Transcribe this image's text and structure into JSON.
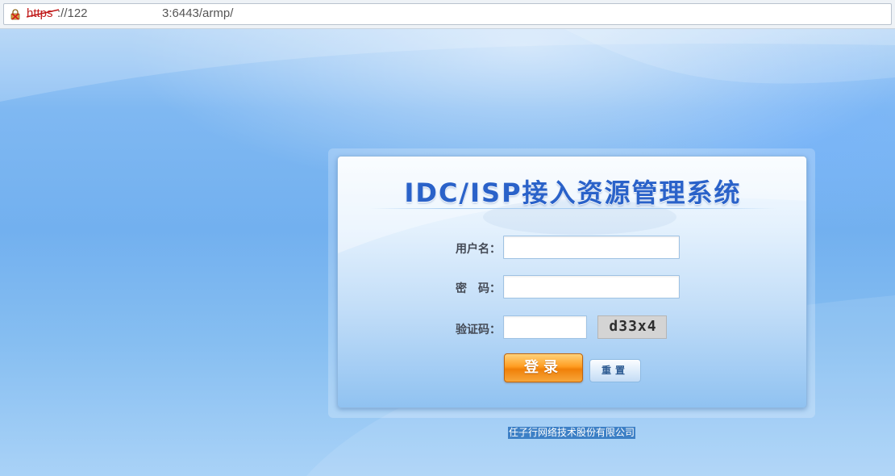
{
  "browser": {
    "url_scheme": "https",
    "url_visible_start": "://122",
    "url_visible_end": "3:6443/armp/",
    "security_icon": "broken-lock-icon"
  },
  "login": {
    "title": "IDC/ISP接入资源管理系统",
    "username_label": "用户名：",
    "username_value": "",
    "password_label": "密　码：",
    "password_value": "",
    "captcha_label": "验证码：",
    "captcha_value": "",
    "captcha_image_text": "d33x4",
    "login_button": "登录",
    "reset_button": "重置"
  },
  "footer": {
    "company": "任子行网络技术股份有限公司"
  },
  "colors": {
    "title": "#2a62c9",
    "login_button": "#ff9d21",
    "background": "#72b0ef"
  }
}
